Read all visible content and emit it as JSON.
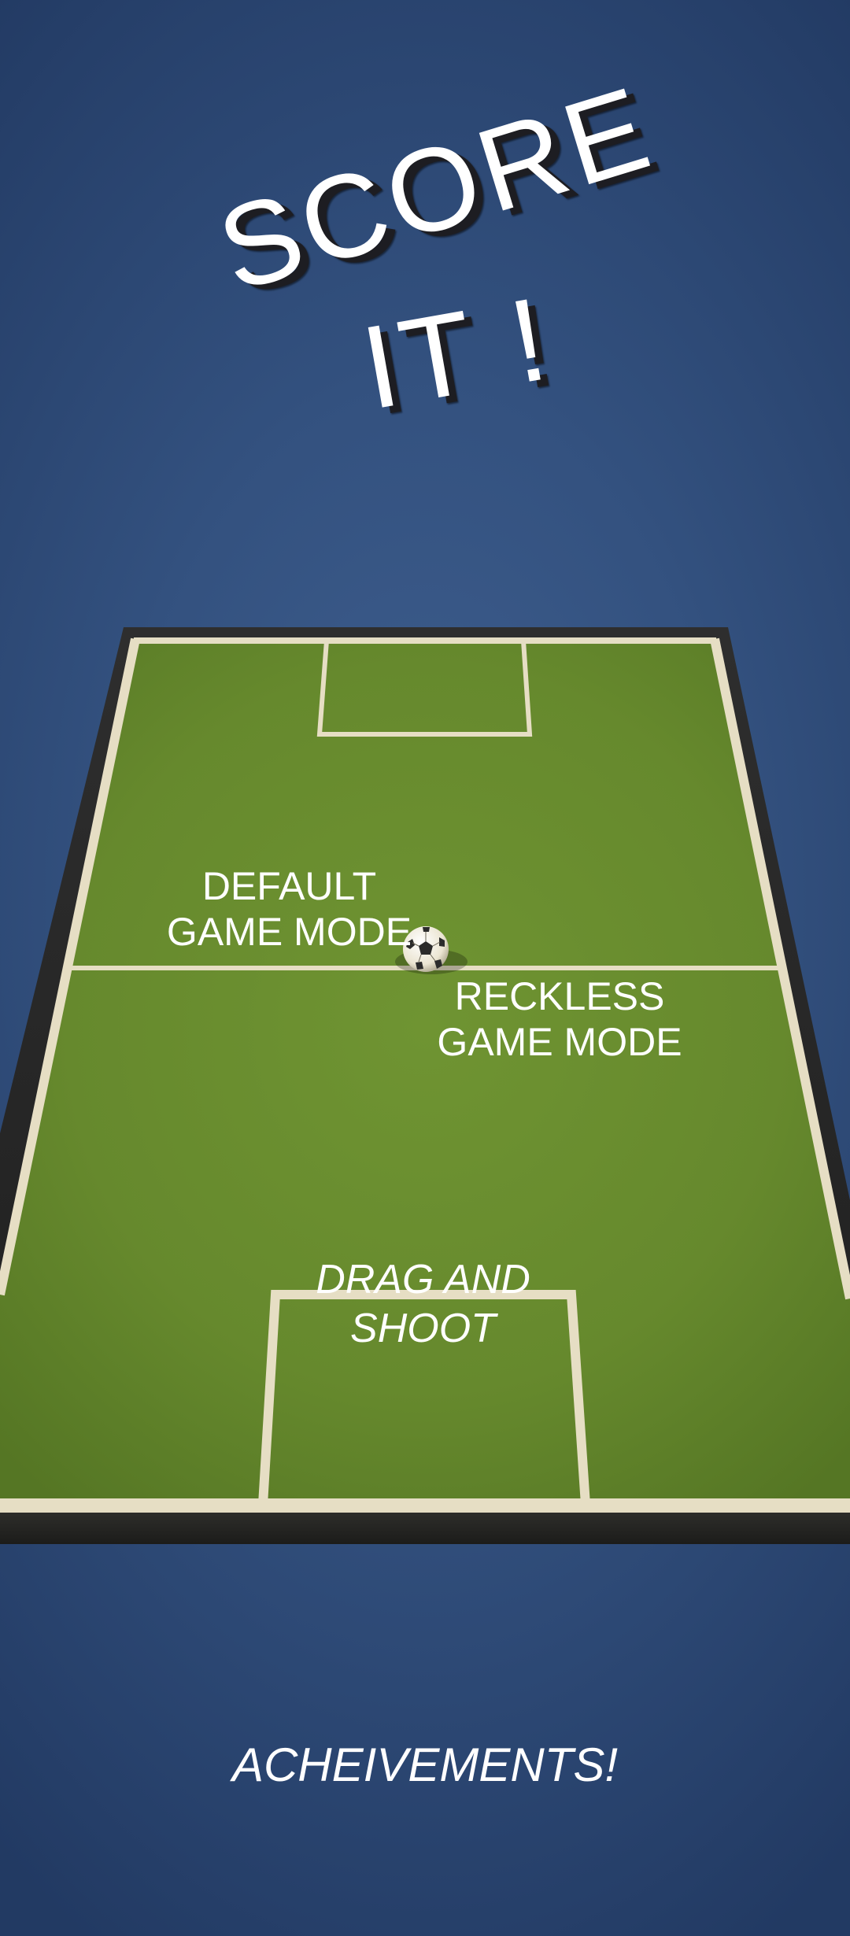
{
  "title": {
    "line1": "SCORE",
    "line2": "IT !"
  },
  "menu": {
    "default_mode": [
      "DEFAULT",
      "GAME MODE"
    ],
    "reckless_mode": [
      "RECKLESS",
      "GAME MODE"
    ],
    "drag_hint": [
      "DRAG AND",
      "SHOOT"
    ],
    "achievements": "ACHEIVEMENTS!"
  },
  "colors": {
    "background": "#33517f",
    "pitch": "#6a8e2e",
    "pitch_lines": "#e6dec4",
    "pitch_border": "#262626",
    "text": "#ffffff"
  },
  "icons": {
    "ball": "soccer-ball-icon"
  }
}
